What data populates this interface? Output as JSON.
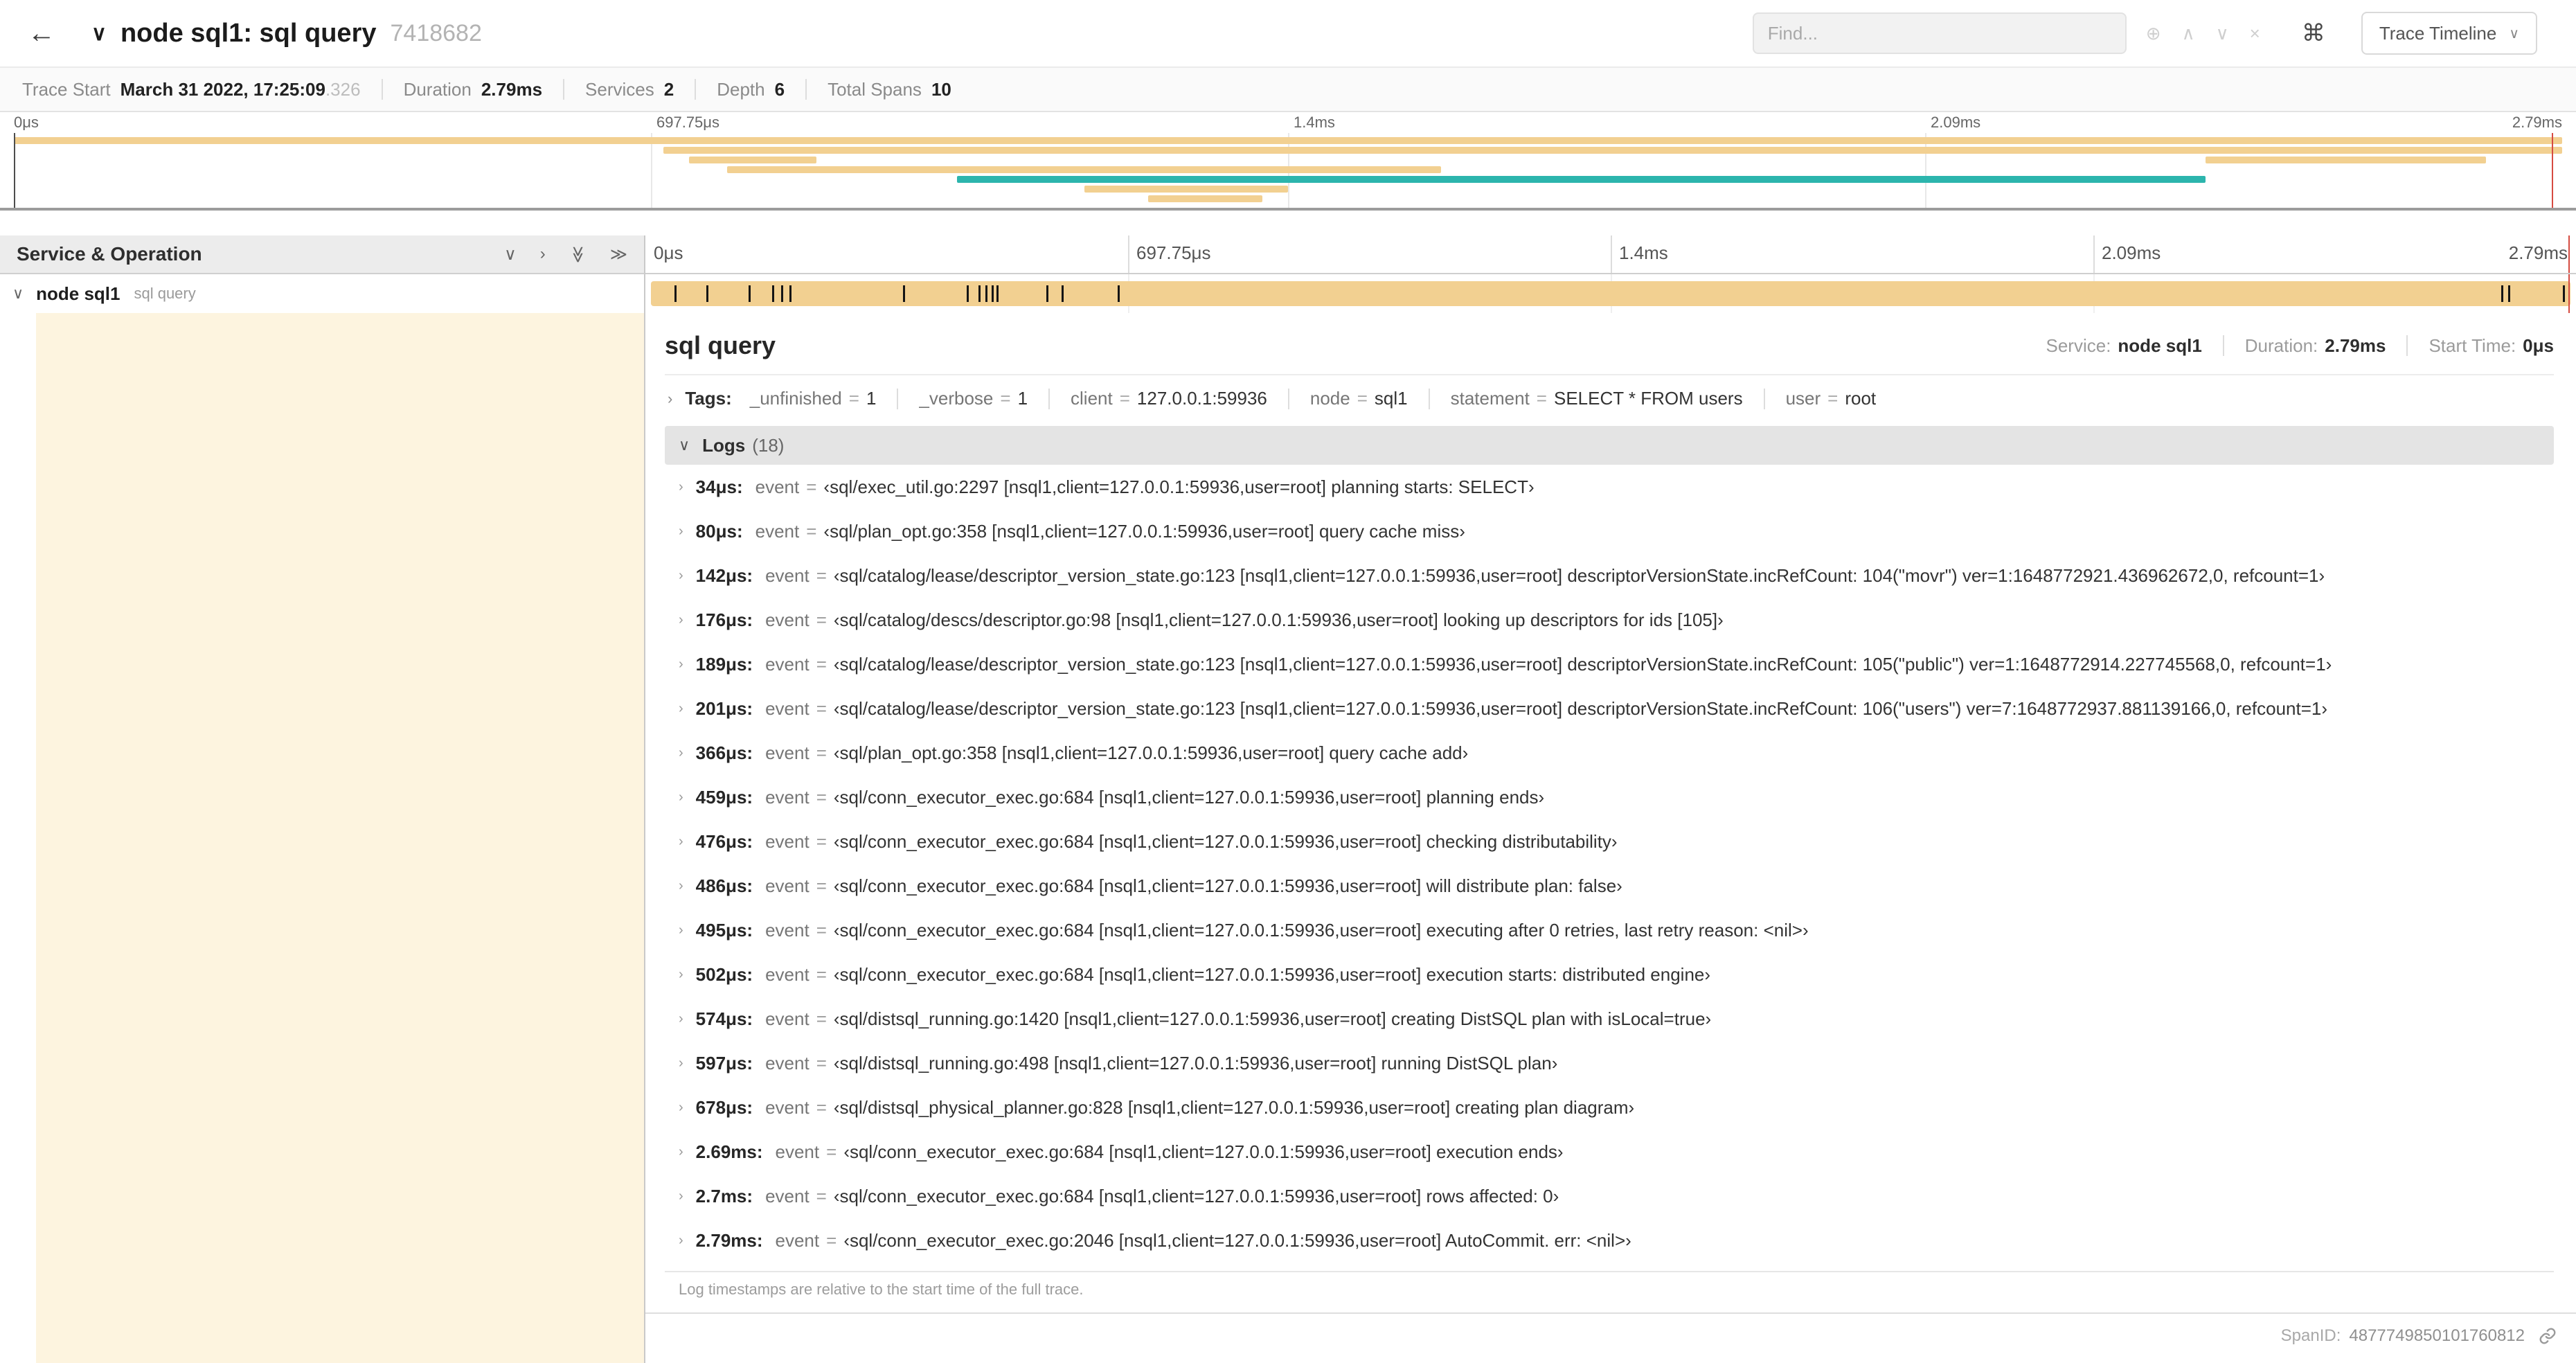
{
  "colors": {
    "bar_tan": "#f2d091",
    "bar_teal": "#2cb5ad",
    "detail_tint": "#fdf4df",
    "cursor_red": "#d64b41"
  },
  "icons": {
    "back": "←",
    "title_chevron": "∨",
    "focus": "⊕",
    "prev": "∧",
    "next": "∨",
    "clear": "×",
    "keyboard": "⌘",
    "caret": "∨",
    "collapse_one": "∨",
    "expand_one": "›",
    "collapse_all": "≫",
    "expand_all": "≫",
    "row_expanded": "∨",
    "row_collapsed": "›"
  },
  "header": {
    "title": "node sql1: sql query",
    "trace_id": "7418682",
    "find_placeholder": "Find...",
    "view_dropdown": "Trace Timeline"
  },
  "summary": {
    "items": [
      {
        "label": "Trace Start",
        "value": "March 31 2022, 17:25:09",
        "suffix": ".326"
      },
      {
        "label": "Duration",
        "value": "2.79ms"
      },
      {
        "label": "Services",
        "value": "2"
      },
      {
        "label": "Depth",
        "value": "6"
      },
      {
        "label": "Total Spans",
        "value": "10"
      }
    ]
  },
  "minimap": {
    "ticks": [
      "0μs",
      "697.75μs",
      "1.4ms",
      "2.09ms",
      "2.79ms"
    ],
    "bars": [
      {
        "row": 0,
        "start": 0,
        "end": 100,
        "color": "tan"
      },
      {
        "row": 1,
        "start": 25.5,
        "end": 100,
        "color": "tan"
      },
      {
        "row": 2,
        "start": 26.5,
        "end": 31.5,
        "color": "tan"
      },
      {
        "row": 2,
        "start": 86,
        "end": 97,
        "color": "tan"
      },
      {
        "row": 3,
        "start": 28,
        "end": 56,
        "color": "tan"
      },
      {
        "row": 4,
        "start": 37,
        "end": 86,
        "color": "teal"
      },
      {
        "row": 5,
        "start": 42,
        "end": 50,
        "color": "tan"
      },
      {
        "row": 6,
        "start": 44.5,
        "end": 49,
        "color": "tan"
      }
    ]
  },
  "timeline": {
    "left_header": "Service & Operation",
    "ticks": [
      "0μs",
      "697.75μs",
      "1.4ms",
      "2.09ms",
      "2.79ms"
    ],
    "duration_us": 2790
  },
  "span_row": {
    "service": "node sql1",
    "operation": "sql query"
  },
  "detail": {
    "eq": "=",
    "title": "sql query",
    "meta": [
      {
        "label": "Service:",
        "value": "node sql1"
      },
      {
        "label": "Duration:",
        "value": "2.79ms"
      },
      {
        "label": "Start Time:",
        "value": "0μs"
      }
    ],
    "tags_label": "Tags:",
    "tags": [
      {
        "key": "_unfinished",
        "value": "1"
      },
      {
        "key": "_verbose",
        "value": "1"
      },
      {
        "key": "client",
        "value": "127.0.0.1:59936"
      },
      {
        "key": "node",
        "value": "sql1"
      },
      {
        "key": "statement",
        "value": "SELECT * FROM users"
      },
      {
        "key": "user",
        "value": "root"
      }
    ],
    "logs_label": "Logs",
    "logs_count": "(18)",
    "logs": [
      {
        "time": "34μs:",
        "t_us": 34,
        "key": "event",
        "value": "‹sql/exec_util.go:2297 [nsql1,client=127.0.0.1:59936,user=root] planning starts: SELECT›"
      },
      {
        "time": "80μs:",
        "t_us": 80,
        "key": "event",
        "value": "‹sql/plan_opt.go:358 [nsql1,client=127.0.0.1:59936,user=root] query cache miss›"
      },
      {
        "time": "142μs:",
        "t_us": 142,
        "key": "event",
        "value": "‹sql/catalog/lease/descriptor_version_state.go:123 [nsql1,client=127.0.0.1:59936,user=root] descriptorVersionState.incRefCount: 104(\"movr\") ver=1:1648772921.436962672,0, refcount=1›"
      },
      {
        "time": "176μs:",
        "t_us": 176,
        "key": "event",
        "value": "‹sql/catalog/descs/descriptor.go:98 [nsql1,client=127.0.0.1:59936,user=root] looking up descriptors for ids [105]›"
      },
      {
        "time": "189μs:",
        "t_us": 189,
        "key": "event",
        "value": "‹sql/catalog/lease/descriptor_version_state.go:123 [nsql1,client=127.0.0.1:59936,user=root] descriptorVersionState.incRefCount: 105(\"public\") ver=1:1648772914.227745568,0, refcount=1›"
      },
      {
        "time": "201μs:",
        "t_us": 201,
        "key": "event",
        "value": "‹sql/catalog/lease/descriptor_version_state.go:123 [nsql1,client=127.0.0.1:59936,user=root] descriptorVersionState.incRefCount: 106(\"users\") ver=7:1648772937.881139166,0, refcount=1›"
      },
      {
        "time": "366μs:",
        "t_us": 366,
        "key": "event",
        "value": "‹sql/plan_opt.go:358 [nsql1,client=127.0.0.1:59936,user=root] query cache add›"
      },
      {
        "time": "459μs:",
        "t_us": 459,
        "key": "event",
        "value": "‹sql/conn_executor_exec.go:684 [nsql1,client=127.0.0.1:59936,user=root] planning ends›"
      },
      {
        "time": "476μs:",
        "t_us": 476,
        "key": "event",
        "value": "‹sql/conn_executor_exec.go:684 [nsql1,client=127.0.0.1:59936,user=root] checking distributability›"
      },
      {
        "time": "486μs:",
        "t_us": 486,
        "key": "event",
        "value": "‹sql/conn_executor_exec.go:684 [nsql1,client=127.0.0.1:59936,user=root] will distribute plan: false›"
      },
      {
        "time": "495μs:",
        "t_us": 495,
        "key": "event",
        "value": "‹sql/conn_executor_exec.go:684 [nsql1,client=127.0.0.1:59936,user=root] executing after 0 retries, last retry reason: <nil>›"
      },
      {
        "time": "502μs:",
        "t_us": 502,
        "key": "event",
        "value": "‹sql/conn_executor_exec.go:684 [nsql1,client=127.0.0.1:59936,user=root] execution starts: distributed engine›"
      },
      {
        "time": "574μs:",
        "t_us": 574,
        "key": "event",
        "value": "‹sql/distsql_running.go:1420 [nsql1,client=127.0.0.1:59936,user=root] creating DistSQL plan with isLocal=true›"
      },
      {
        "time": "597μs:",
        "t_us": 597,
        "key": "event",
        "value": "‹sql/distsql_running.go:498 [nsql1,client=127.0.0.1:59936,user=root] running DistSQL plan›"
      },
      {
        "time": "678μs:",
        "t_us": 678,
        "key": "event",
        "value": "‹sql/distsql_physical_planner.go:828 [nsql1,client=127.0.0.1:59936,user=root] creating plan diagram›"
      },
      {
        "time": "2.69ms:",
        "t_us": 2690,
        "key": "event",
        "value": "‹sql/conn_executor_exec.go:684 [nsql1,client=127.0.0.1:59936,user=root] execution ends›"
      },
      {
        "time": "2.7ms:",
        "t_us": 2700,
        "key": "event",
        "value": "‹sql/conn_executor_exec.go:684 [nsql1,client=127.0.0.1:59936,user=root] rows affected: 0›"
      },
      {
        "time": "2.79ms:",
        "t_us": 2790,
        "key": "event",
        "value": "‹sql/conn_executor_exec.go:2046 [nsql1,client=127.0.0.1:59936,user=root] AutoCommit. err: <nil>›"
      }
    ],
    "footer_note": "Log timestamps are relative to the start time of the full trace.",
    "span_id_label": "SpanID:",
    "span_id": "4877749850101760812"
  }
}
